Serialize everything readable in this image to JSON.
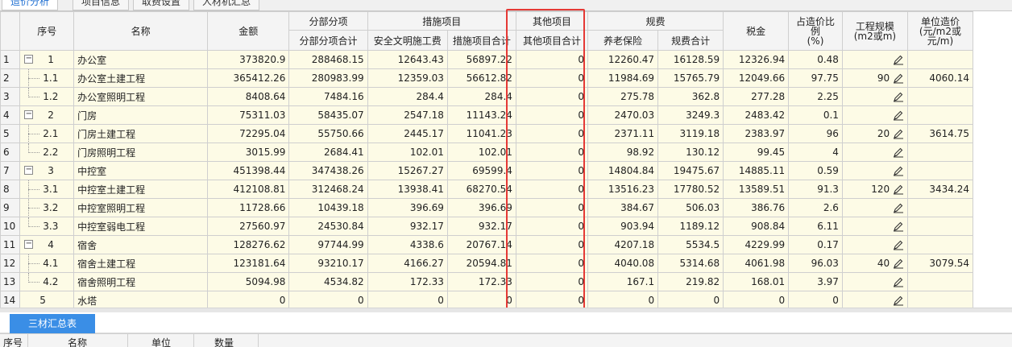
{
  "tabs": [
    {
      "label": "造价分析",
      "active": true
    },
    {
      "label": "项目信息",
      "active": false
    },
    {
      "label": "取费设置",
      "active": false
    },
    {
      "label": "人材机汇总",
      "active": false
    }
  ],
  "columns": {
    "seq": "序号",
    "name": "名称",
    "amount": "金额",
    "fbfx_group": "分部分项",
    "fbfx_total": "分部分项合计",
    "csxm_group": "措施项目",
    "aqwm": "安全文明施工费",
    "csxm_total": "措施项目合计",
    "qtxm_group": "其他项目",
    "qtxm_total": "其他项目合计",
    "gf_group": "规费",
    "ylbx": "养老保险",
    "gf_total": "规费合计",
    "tax": "税金",
    "ratio": "占造价比例\n(%)",
    "scale": "工程规模\n(m2或m)",
    "unit_price": "单位造价\n(元/m2或元/m)"
  },
  "rows": [
    {
      "rn": "1",
      "seq": "1",
      "level": 0,
      "expander": "−",
      "name": "办公室",
      "amount": "373820.9",
      "fbfx": "288468.15",
      "aqwm": "12643.43",
      "csxm": "56897.22",
      "qtxm": "0",
      "ylbx": "12260.47",
      "gf": "16128.59",
      "tax": "12326.94",
      "ratio": "0.48",
      "scale": "",
      "unit": ""
    },
    {
      "rn": "2",
      "seq": "1.1",
      "level": 1,
      "expander": "",
      "name": "办公室土建工程",
      "amount": "365412.26",
      "fbfx": "280983.99",
      "aqwm": "12359.03",
      "csxm": "56612.82",
      "qtxm": "0",
      "ylbx": "11984.69",
      "gf": "15765.79",
      "tax": "12049.66",
      "ratio": "97.75",
      "scale": "90",
      "unit": "4060.14"
    },
    {
      "rn": "3",
      "seq": "1.2",
      "level": 1,
      "last": true,
      "expander": "",
      "name": "办公室照明工程",
      "amount": "8408.64",
      "fbfx": "7484.16",
      "aqwm": "284.4",
      "csxm": "284.4",
      "qtxm": "0",
      "ylbx": "275.78",
      "gf": "362.8",
      "tax": "277.28",
      "ratio": "2.25",
      "scale": "",
      "unit": ""
    },
    {
      "rn": "4",
      "seq": "2",
      "level": 0,
      "expander": "−",
      "name": "门房",
      "amount": "75311.03",
      "fbfx": "58435.07",
      "aqwm": "2547.18",
      "csxm": "11143.24",
      "qtxm": "0",
      "ylbx": "2470.03",
      "gf": "3249.3",
      "tax": "2483.42",
      "ratio": "0.1",
      "scale": "",
      "unit": ""
    },
    {
      "rn": "5",
      "seq": "2.1",
      "level": 1,
      "expander": "",
      "name": "门房土建工程",
      "amount": "72295.04",
      "fbfx": "55750.66",
      "aqwm": "2445.17",
      "csxm": "11041.23",
      "qtxm": "0",
      "ylbx": "2371.11",
      "gf": "3119.18",
      "tax": "2383.97",
      "ratio": "96",
      "scale": "20",
      "unit": "3614.75"
    },
    {
      "rn": "6",
      "seq": "2.2",
      "level": 1,
      "last": true,
      "expander": "",
      "name": "门房照明工程",
      "amount": "3015.99",
      "fbfx": "2684.41",
      "aqwm": "102.01",
      "csxm": "102.01",
      "qtxm": "0",
      "ylbx": "98.92",
      "gf": "130.12",
      "tax": "99.45",
      "ratio": "4",
      "scale": "",
      "unit": ""
    },
    {
      "rn": "7",
      "seq": "3",
      "level": 0,
      "expander": "−",
      "name": "中控室",
      "amount": "451398.44",
      "fbfx": "347438.26",
      "aqwm": "15267.27",
      "csxm": "69599.4",
      "qtxm": "0",
      "ylbx": "14804.84",
      "gf": "19475.67",
      "tax": "14885.11",
      "ratio": "0.59",
      "scale": "",
      "unit": ""
    },
    {
      "rn": "8",
      "seq": "3.1",
      "level": 1,
      "expander": "",
      "name": "中控室土建工程",
      "amount": "412108.81",
      "fbfx": "312468.24",
      "aqwm": "13938.41",
      "csxm": "68270.54",
      "qtxm": "0",
      "ylbx": "13516.23",
      "gf": "17780.52",
      "tax": "13589.51",
      "ratio": "91.3",
      "scale": "120",
      "unit": "3434.24"
    },
    {
      "rn": "9",
      "seq": "3.2",
      "level": 1,
      "expander": "",
      "name": "中控室照明工程",
      "amount": "11728.66",
      "fbfx": "10439.18",
      "aqwm": "396.69",
      "csxm": "396.69",
      "qtxm": "0",
      "ylbx": "384.67",
      "gf": "506.03",
      "tax": "386.76",
      "ratio": "2.6",
      "scale": "",
      "unit": ""
    },
    {
      "rn": "10",
      "seq": "3.3",
      "level": 1,
      "last": true,
      "expander": "",
      "name": "中控室弱电工程",
      "amount": "27560.97",
      "fbfx": "24530.84",
      "aqwm": "932.17",
      "csxm": "932.17",
      "qtxm": "0",
      "ylbx": "903.94",
      "gf": "1189.12",
      "tax": "908.84",
      "ratio": "6.11",
      "scale": "",
      "unit": ""
    },
    {
      "rn": "11",
      "seq": "4",
      "level": 0,
      "expander": "−",
      "name": "宿舍",
      "amount": "128276.62",
      "fbfx": "97744.99",
      "aqwm": "4338.6",
      "csxm": "20767.14",
      "qtxm": "0",
      "ylbx": "4207.18",
      "gf": "5534.5",
      "tax": "4229.99",
      "ratio": "0.17",
      "scale": "",
      "unit": ""
    },
    {
      "rn": "12",
      "seq": "4.1",
      "level": 1,
      "expander": "",
      "name": "宿舍土建工程",
      "amount": "123181.64",
      "fbfx": "93210.17",
      "aqwm": "4166.27",
      "csxm": "20594.81",
      "qtxm": "0",
      "ylbx": "4040.08",
      "gf": "5314.68",
      "tax": "4061.98",
      "ratio": "96.03",
      "scale": "40",
      "unit": "3079.54"
    },
    {
      "rn": "13",
      "seq": "4.2",
      "level": 1,
      "last": true,
      "expander": "",
      "name": "宿舍照明工程",
      "amount": "5094.98",
      "fbfx": "4534.82",
      "aqwm": "172.33",
      "csxm": "172.33",
      "qtxm": "0",
      "ylbx": "167.1",
      "gf": "219.82",
      "tax": "168.01",
      "ratio": "3.97",
      "scale": "",
      "unit": ""
    },
    {
      "rn": "14",
      "seq": "5",
      "level": -1,
      "expander": "",
      "name": "水塔",
      "amount": "0",
      "fbfx": "0",
      "aqwm": "0",
      "csxm": "0",
      "qtxm": "0",
      "ylbx": "0",
      "gf": "0",
      "tax": "0",
      "ratio": "0",
      "scale": "",
      "unit": ""
    }
  ],
  "bottom": {
    "button_label": "三材汇总表",
    "headers": [
      "序号",
      "名称",
      "单位",
      "数量"
    ]
  },
  "colors": {
    "accent": "#3a8ee6",
    "highlight": "#e53935",
    "row_bg": "#fdfbe6"
  },
  "icons": {
    "edit": "pencil-icon",
    "collapse": "collapse-icon"
  }
}
